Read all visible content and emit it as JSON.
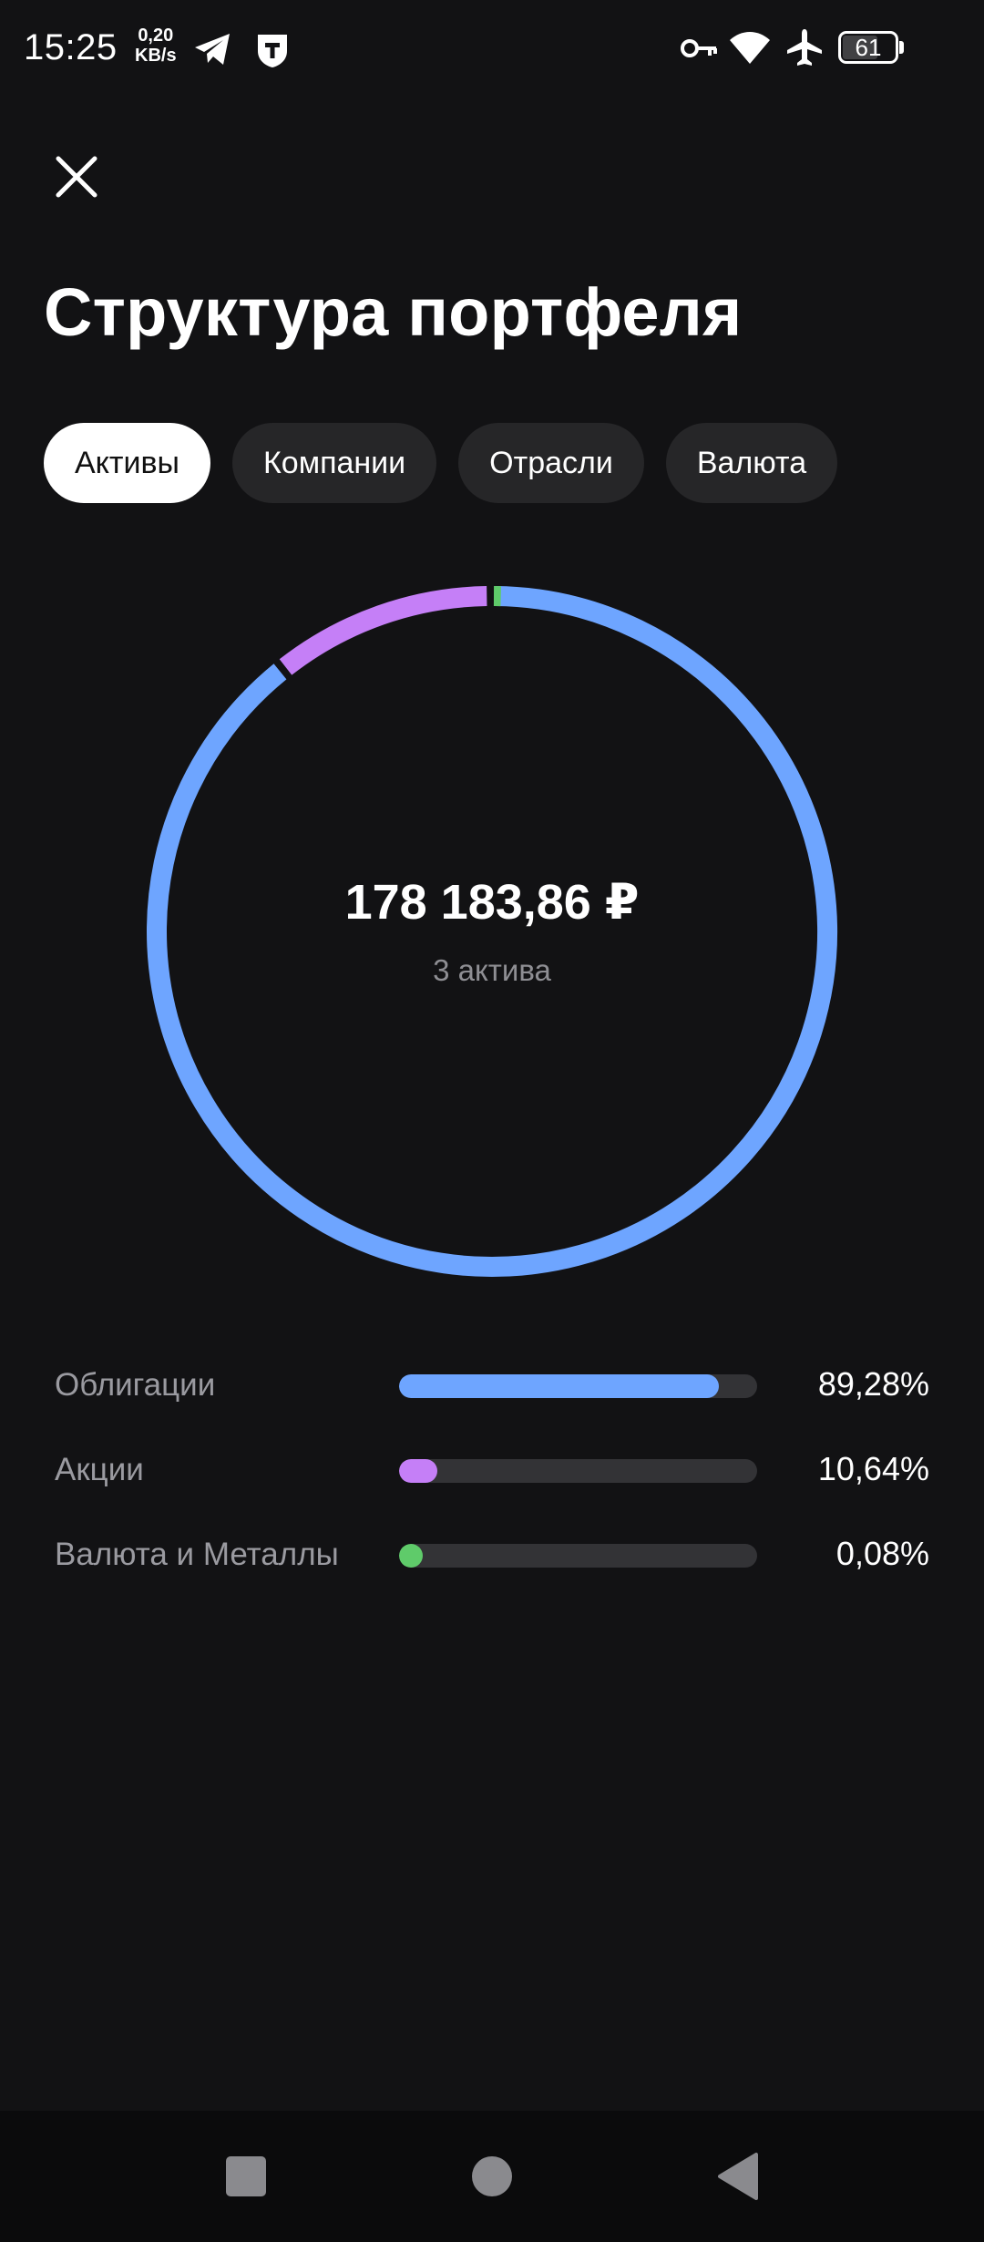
{
  "status_bar": {
    "time": "15:25",
    "net_speed_value": "0,20",
    "net_speed_unit": "KB/s",
    "battery": "61",
    "icons": [
      "telegram-icon",
      "tinkoff-icon",
      "vpn-key-icon",
      "wifi-icon",
      "airplane-icon",
      "battery-icon"
    ]
  },
  "header": {
    "close_icon": "close-icon",
    "title": "Структура портфеля"
  },
  "tabs": [
    {
      "label": "Активы",
      "active": true
    },
    {
      "label": "Компании",
      "active": false
    },
    {
      "label": "Отрасли",
      "active": false
    },
    {
      "label": "Валюта",
      "active": false
    }
  ],
  "summary": {
    "total": "178 183,86 ₽",
    "assets_count": "3 актива"
  },
  "chart_data": {
    "type": "pie",
    "categories": [
      "Облигации",
      "Акции",
      "Валюта и Металлы"
    ],
    "values": [
      89.28,
      10.64,
      0.08
    ],
    "colors": [
      "#6ea5ff",
      "#c57ff7",
      "#5fcb6a"
    ]
  },
  "legend": [
    {
      "label": "Облигации",
      "value": "89,28%",
      "percent": 89.28,
      "color": "#6ea5ff"
    },
    {
      "label": "Акции",
      "value": "10,64%",
      "percent": 10.64,
      "color": "#c57ff7"
    },
    {
      "label": "Валюта и Металлы",
      "value": "0,08%",
      "percent": 0.08,
      "color": "#5fcb6a"
    }
  ],
  "nav_bar": {
    "icons": [
      "recents-square-icon",
      "home-circle-icon",
      "back-triangle-icon"
    ]
  }
}
